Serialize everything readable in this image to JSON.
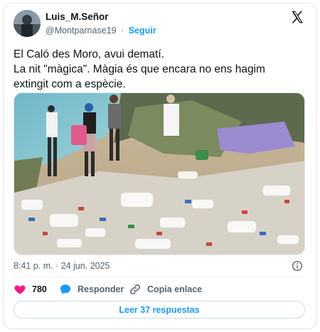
{
  "author": {
    "name": "Luis_M.Señor",
    "handle": "@Montparnase19",
    "separator": "·",
    "follow_label": "Seguir"
  },
  "tweet": {
    "lines": [
      "El Caló des Moro, avui dematí.",
      "La nit \"màgica\". Màgia és que encara no ens hagim",
      "extingit com a espècie."
    ],
    "timestamp": "8:41 p. m. · 24 jun. 2025"
  },
  "actions": {
    "like_count": "780",
    "reply_label": "Responder",
    "copy_label": "Copia enlace"
  },
  "replies_button": "Leer 37 respuestas",
  "colors": {
    "accent": "#1d9bf0",
    "like": "#f91880",
    "secondary_text": "#536471"
  }
}
